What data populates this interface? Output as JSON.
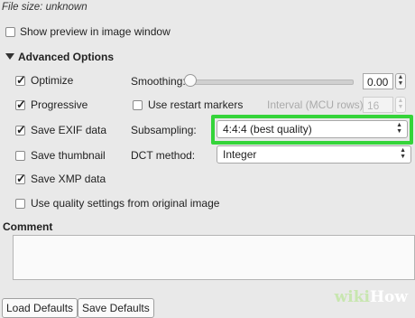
{
  "file_size_text": "File size: unknown",
  "show_preview": {
    "label": "Show preview in image window",
    "checked": false
  },
  "advanced": {
    "title": "Advanced Options"
  },
  "options": {
    "optimize": {
      "label": "Optimize",
      "checked": true
    },
    "progressive": {
      "label": "Progressive",
      "checked": true
    },
    "save_exif": {
      "label": "Save EXIF data",
      "checked": true
    },
    "save_thumbnail": {
      "label": "Save thumbnail",
      "checked": false
    },
    "save_xmp": {
      "label": "Save XMP data",
      "checked": true
    },
    "use_quality": {
      "label": "Use quality settings from original image",
      "checked": false
    },
    "restart_markers": {
      "label": "Use restart markers",
      "checked": false
    }
  },
  "smoothing": {
    "label": "Smoothing:",
    "value": "0.00"
  },
  "interval": {
    "label": "Interval (MCU rows):",
    "value": "16"
  },
  "subsampling": {
    "label": "Subsampling:",
    "value": "4:4:4 (best quality)"
  },
  "dct": {
    "label": "DCT method:",
    "value": "Integer"
  },
  "comment": {
    "label": "Comment",
    "value": ""
  },
  "buttons": {
    "load_defaults": "Load Defaults",
    "save_defaults": "Save Defaults"
  },
  "watermark": {
    "prefix": "wiki",
    "suffix": "How"
  },
  "colors": {
    "highlight": "#35d43a",
    "background": "#e9e9e9"
  },
  "icons": {
    "expand": "disclosure-triangle-icon",
    "checkbox_checked": "checkmark-icon"
  }
}
